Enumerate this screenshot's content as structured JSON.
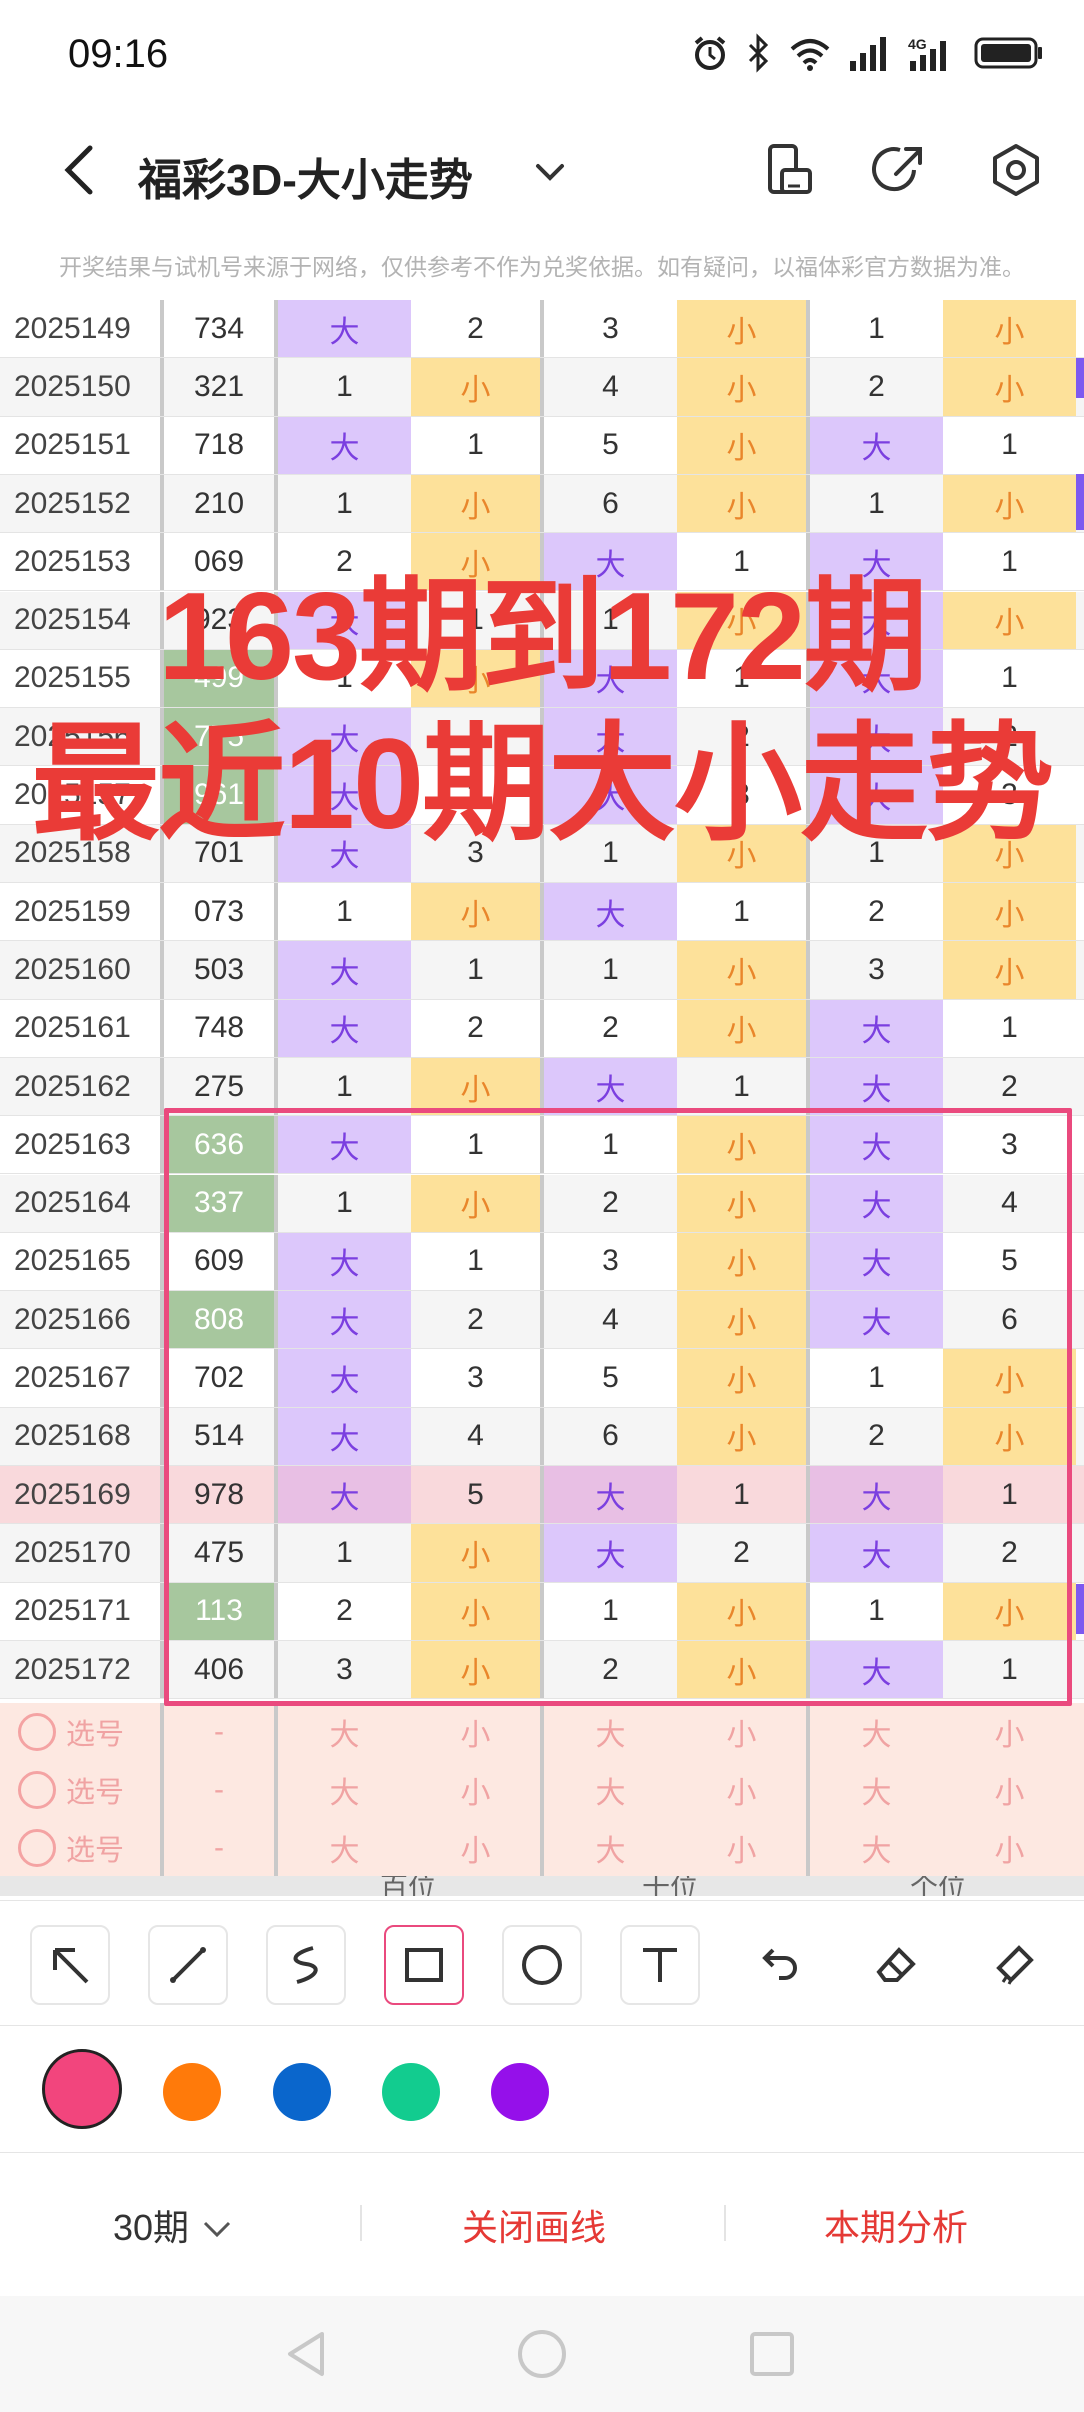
{
  "status": {
    "time": "09:16",
    "network": "4G"
  },
  "header": {
    "title": "福彩3D-大小走势"
  },
  "notice": "开奖结果与试机号来源于网络，仅供参考不作为兑奖依据。如有疑问，以福体彩官方数据为准。",
  "rows": [
    {
      "issue": "2025149",
      "num": "734",
      "g": false,
      "c": [
        "大",
        "2",
        "3",
        "小",
        "1",
        "小"
      ]
    },
    {
      "issue": "2025150",
      "num": "321",
      "g": false,
      "c": [
        "1",
        "小",
        "4",
        "小",
        "2",
        "小"
      ]
    },
    {
      "issue": "2025151",
      "num": "718",
      "g": false,
      "c": [
        "大",
        "1",
        "5",
        "小",
        "大",
        "1"
      ]
    },
    {
      "issue": "2025152",
      "num": "210",
      "g": false,
      "c": [
        "1",
        "小",
        "6",
        "小",
        "1",
        "小"
      ]
    },
    {
      "issue": "2025153",
      "num": "069",
      "g": false,
      "c": [
        "2",
        "小",
        "大",
        "1",
        "大",
        "1"
      ]
    },
    {
      "issue": "2025154",
      "num": "923",
      "g": false,
      "c": [
        "大",
        "1",
        "1",
        "小",
        "大",
        "小"
      ]
    },
    {
      "issue": "2025155",
      "num": "499",
      "g": true,
      "c": [
        "1",
        "小",
        "大",
        "1",
        "大",
        "1"
      ]
    },
    {
      "issue": "2025156",
      "num": "775",
      "g": true,
      "c": [
        "大",
        "1",
        "大",
        "2",
        "大",
        "2"
      ]
    },
    {
      "issue": "2025157",
      "num": "961",
      "g": true,
      "c": [
        "大",
        "2",
        "大",
        "3",
        "大",
        "3"
      ]
    },
    {
      "issue": "2025158",
      "num": "701",
      "g": false,
      "c": [
        "大",
        "3",
        "1",
        "小",
        "1",
        "小"
      ]
    },
    {
      "issue": "2025159",
      "num": "073",
      "g": false,
      "c": [
        "1",
        "小",
        "大",
        "1",
        "2",
        "小"
      ]
    },
    {
      "issue": "2025160",
      "num": "503",
      "g": false,
      "c": [
        "大",
        "1",
        "1",
        "小",
        "3",
        "小"
      ]
    },
    {
      "issue": "2025161",
      "num": "748",
      "g": false,
      "c": [
        "大",
        "2",
        "2",
        "小",
        "大",
        "1"
      ]
    },
    {
      "issue": "2025162",
      "num": "275",
      "g": false,
      "c": [
        "1",
        "小",
        "大",
        "1",
        "大",
        "2"
      ]
    },
    {
      "issue": "2025163",
      "num": "636",
      "g": true,
      "c": [
        "大",
        "1",
        "1",
        "小",
        "大",
        "3"
      ]
    },
    {
      "issue": "2025164",
      "num": "337",
      "g": true,
      "c": [
        "1",
        "小",
        "2",
        "小",
        "大",
        "4"
      ]
    },
    {
      "issue": "2025165",
      "num": "609",
      "g": false,
      "c": [
        "大",
        "1",
        "3",
        "小",
        "大",
        "5"
      ]
    },
    {
      "issue": "2025166",
      "num": "808",
      "g": true,
      "c": [
        "大",
        "2",
        "4",
        "小",
        "大",
        "6"
      ]
    },
    {
      "issue": "2025167",
      "num": "702",
      "g": false,
      "c": [
        "大",
        "3",
        "5",
        "小",
        "1",
        "小"
      ]
    },
    {
      "issue": "2025168",
      "num": "514",
      "g": false,
      "c": [
        "大",
        "4",
        "6",
        "小",
        "2",
        "小"
      ]
    },
    {
      "issue": "2025169",
      "num": "978",
      "g": false,
      "c": [
        "大",
        "5",
        "大",
        "1",
        "大",
        "1"
      ]
    },
    {
      "issue": "2025170",
      "num": "475",
      "g": false,
      "c": [
        "1",
        "小",
        "大",
        "2",
        "大",
        "2"
      ]
    },
    {
      "issue": "2025171",
      "num": "113",
      "g": true,
      "c": [
        "2",
        "小",
        "1",
        "小",
        "1",
        "小"
      ]
    },
    {
      "issue": "2025172",
      "num": "406",
      "g": false,
      "c": [
        "3",
        "小",
        "2",
        "小",
        "大",
        "1"
      ]
    }
  ],
  "pick": {
    "label": "选号",
    "dash": "-",
    "big": "大",
    "small": "小"
  },
  "positions": [
    "百位",
    "十位",
    "个位"
  ],
  "overlay": {
    "line1": "163期到172期",
    "line2": "最近10期大小走势"
  },
  "tools": [
    "arrow-tool",
    "line-tool",
    "freehand-tool",
    "rectangle-tool",
    "circle-tool",
    "text-tool",
    "undo-tool",
    "eraser-tool",
    "clear-tool"
  ],
  "colors": [
    "#f2457d",
    "#ff7a0a",
    "#0a66cc",
    "#12cc8f",
    "#9510ea"
  ],
  "bottom": {
    "period": "30期",
    "close": "关闭画线",
    "analysis": "本期分析"
  }
}
